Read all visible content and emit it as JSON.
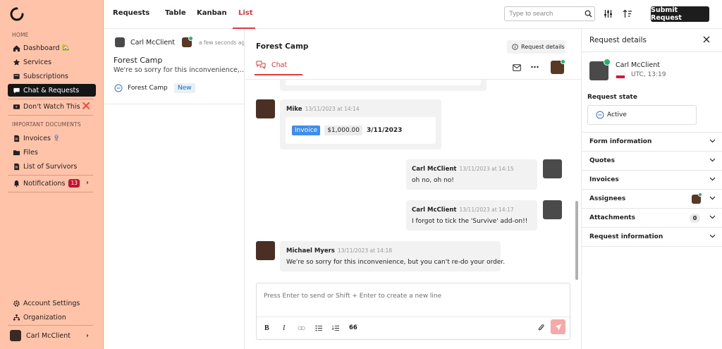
{
  "sidebar": {
    "home_section": "HOME",
    "important_section": "IMPORTANT DOCUMENTS",
    "items": [
      {
        "label": "Dashboard",
        "emoji": "🏡"
      },
      {
        "label": "Services"
      },
      {
        "label": "Subscriptions"
      },
      {
        "label": "Chat & Requests"
      },
      {
        "label": "Don't Watch This",
        "emoji": "❌"
      },
      {
        "label": "Invoices",
        "emoji": "🪢"
      },
      {
        "label": "Files"
      },
      {
        "label": "List of Survivors"
      },
      {
        "label": "Notifications",
        "badge": "13"
      }
    ],
    "footer": {
      "account_settings": "Account Settings",
      "organization": "Organization",
      "user_name": "Carl McClient"
    }
  },
  "topbar": {
    "title": "Requests",
    "tabs": [
      "Table",
      "Kanban",
      "List"
    ],
    "active_tab": "List",
    "search_placeholder": "Type to search",
    "submit_label": "Submit Request"
  },
  "request_list": [
    {
      "client": "Carl McClient",
      "time": "a few seconds ago",
      "title": "Forest Camp",
      "preview": "We're so sorry for this inconvenience,...",
      "project": "Forest Camp",
      "status": "New"
    }
  ],
  "chat": {
    "title": "Forest Camp",
    "details_button": "Request details",
    "tab_label": "Chat",
    "messages": [
      {
        "sender": "Mike",
        "time": "13/11/2023 at 14:14",
        "invoice_tag": "Invoice",
        "amount": "$1,000.00",
        "date": "3/11/2023"
      },
      {
        "sender": "Carl McClient",
        "time": "13/11/2023 at 14:15",
        "text": "oh no, oh no!"
      },
      {
        "sender": "Carl McClient",
        "time": "13/11/2023 at 14:17",
        "text": "I forgot to tick the 'Survive' add-on!!"
      },
      {
        "sender": "Michael Myers",
        "time": "13/11/2023 at 14:18",
        "text": "We're so sorry for this inconvenience, but you can't re-do your order."
      }
    ],
    "composer_placeholder": "Press Enter to send or Shift + Enter to create a new line",
    "quote_icon_text": "66"
  },
  "details": {
    "title": "Request details",
    "client_name": "Carl McClient",
    "client_timezone": "UTC, 13:19",
    "state_label": "Request state",
    "state_value": "Active",
    "sections": [
      "Form information",
      "Quotes",
      "Invoices",
      "Assignees",
      "Attachments",
      "Request information"
    ],
    "attachments_count": "0"
  },
  "colors": {
    "sidebar_bg": "#fec3a8",
    "accent": "#e0393e",
    "online": "#26b36b",
    "invoice_tag": "#3d8ef0",
    "send_button": "#f7a8a8",
    "status_new": "#1565c0"
  }
}
